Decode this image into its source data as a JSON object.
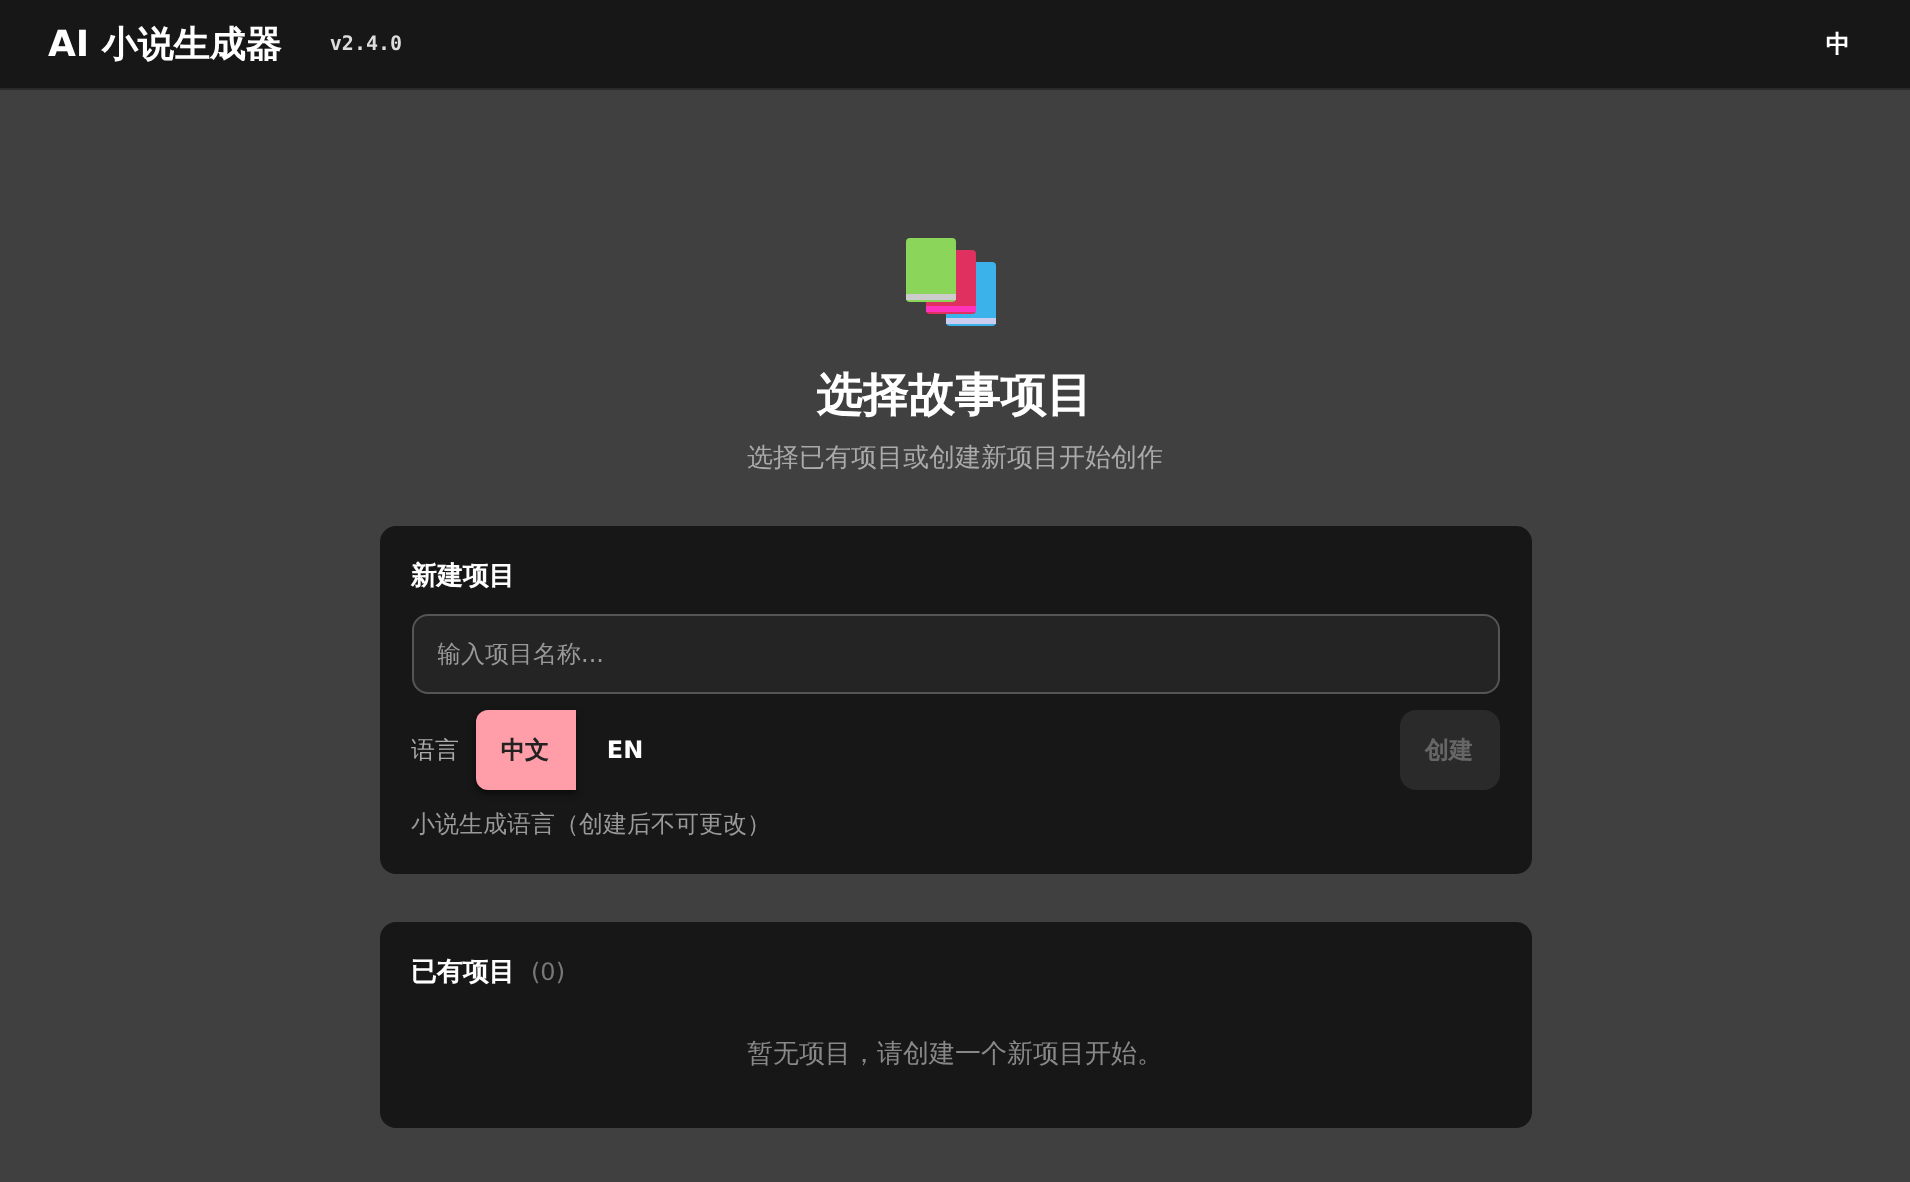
{
  "header": {
    "app_title": "AI 小说生成器",
    "version": "v2.4.0",
    "language_toggle": "中"
  },
  "hero": {
    "title": "选择故事项目",
    "subtitle": "选择已有项目或创建新项目开始创作"
  },
  "new_project": {
    "title": "新建项目",
    "name_field": {
      "placeholder": "输入项目名称..."
    },
    "language_label": "语言",
    "languages": [
      {
        "label": "中文",
        "selected": true
      },
      {
        "label": "EN",
        "selected": false
      }
    ],
    "create_button": {
      "label": "创建",
      "disabled": true
    },
    "hint": "小说生成语言（创建后不可更改）"
  },
  "existing_projects": {
    "title": "已有项目",
    "count": "(0)",
    "empty_message": "暂无项目，请创建一个新项目开始。"
  }
}
